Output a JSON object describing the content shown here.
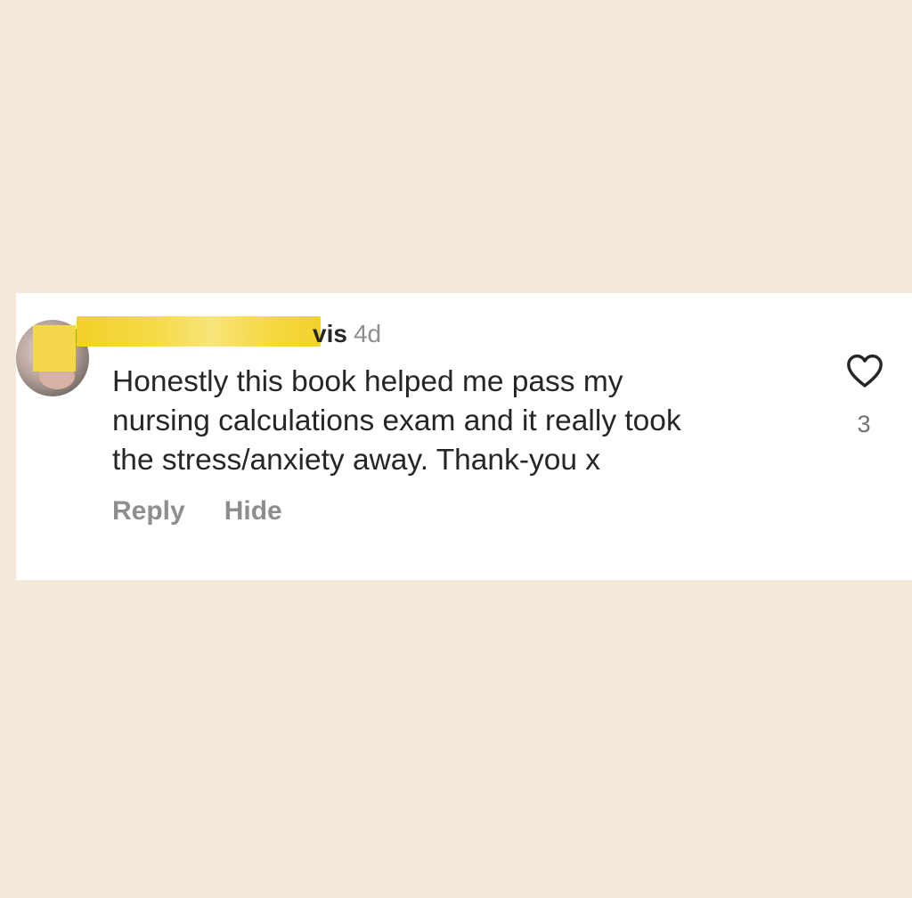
{
  "comment": {
    "username_visible": "vis",
    "timestamp": "4d",
    "text_lines": [
      "Honestly this book helped me pass my",
      "nursing calculations exam and it really took",
      "the stress/anxiety away. Thank-you x"
    ],
    "like_count": "3",
    "actions": {
      "reply_label": "Reply",
      "hide_label": "Hide"
    }
  },
  "icons": {
    "like": "heart-outline-icon"
  },
  "colors": {
    "background": "#f4e8da",
    "card": "#ffffff",
    "redaction": "#f3d22c",
    "text": "#262626",
    "secondary_text": "#8e8e8e"
  }
}
